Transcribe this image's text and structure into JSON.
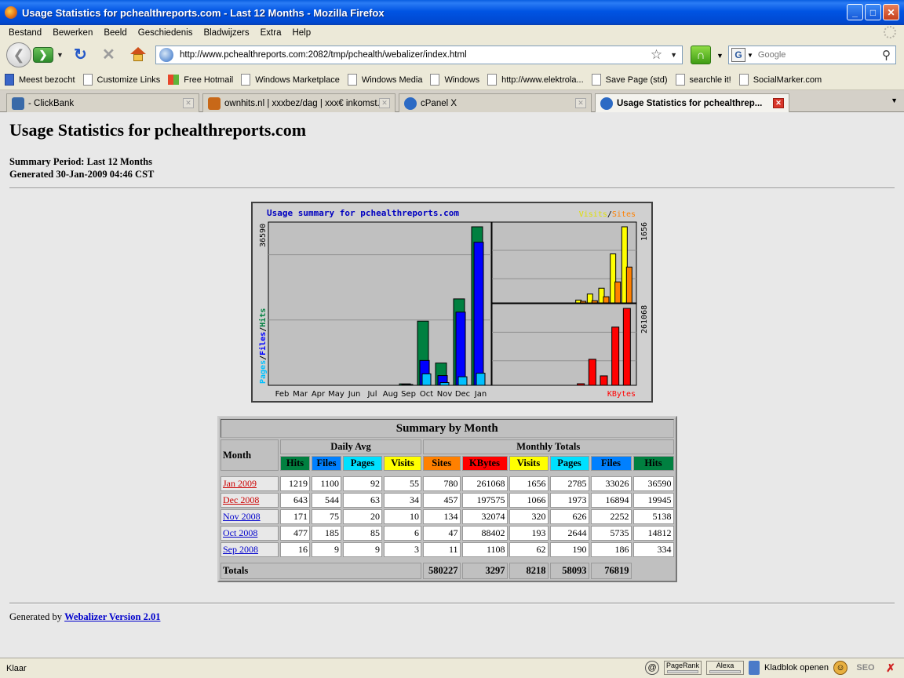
{
  "window": {
    "title": "Usage Statistics for pchealthreports.com - Last 12 Months - Mozilla Firefox",
    "minimize": "_",
    "maximize": "□",
    "close": "✕"
  },
  "menu": [
    "Bestand",
    "Bewerken",
    "Beeld",
    "Geschiedenis",
    "Bladwijzers",
    "Extra",
    "Help"
  ],
  "nav": {
    "url": "http://www.pchealthreports.com:2082/tmp/pchealth/webalizer/index.html",
    "search_placeholder": "Google",
    "search_engine": "G"
  },
  "bookmarks": [
    {
      "label": "Meest bezocht",
      "icon": "smart-folder-icon"
    },
    {
      "label": "Customize Links",
      "icon": "page-icon"
    },
    {
      "label": "Free Hotmail",
      "icon": "windows-logo-icon"
    },
    {
      "label": "Windows Marketplace",
      "icon": "page-icon"
    },
    {
      "label": "Windows Media",
      "icon": "page-icon"
    },
    {
      "label": "Windows",
      "icon": "page-icon"
    },
    {
      "label": "http://www.elektrola...",
      "icon": "page-icon"
    },
    {
      "label": "Save Page (std)",
      "icon": "page-icon"
    },
    {
      "label": "searchle it!",
      "icon": "page-icon"
    },
    {
      "label": "SocialMarker.com",
      "icon": "page-icon"
    }
  ],
  "tabs": [
    {
      "label": "- ClickBank",
      "active": false,
      "color": "#3a6aa8"
    },
    {
      "label": "ownhits.nl | xxxbez/dag | xxx€ inkomst...",
      "active": false,
      "color": "#c86818"
    },
    {
      "label": "cPanel X",
      "active": false,
      "color": "#2c6ac4"
    },
    {
      "label": "Usage Statistics for pchealthrep...",
      "active": true,
      "color": "#2c6ac4"
    }
  ],
  "page": {
    "title": "Usage Statistics for pchealthreports.com",
    "summary_period": "Summary Period: Last 12 Months",
    "generated": "Generated 30-Jan-2009 04:46 CST",
    "footer_prefix": "Generated by",
    "footer_link": "Webalizer Version 2.01"
  },
  "chart_data": {
    "type": "bar",
    "title": "Usage summary for pchealthreports.com",
    "categories": [
      "Feb",
      "Mar",
      "Apr",
      "May",
      "Jun",
      "Jul",
      "Aug",
      "Sep",
      "Oct",
      "Nov",
      "Dec",
      "Jan"
    ],
    "panels": [
      {
        "name": "left",
        "ylabel": [
          "Pages",
          "Files",
          "Hits"
        ],
        "ymax_label": "36590",
        "series": [
          {
            "name": "Hits",
            "color": "#008040",
            "values": [
              0,
              0,
              0,
              0,
              0,
              0,
              0,
              334,
              14812,
              5138,
              19945,
              36590
            ]
          },
          {
            "name": "Files",
            "color": "#0000ff",
            "values": [
              0,
              0,
              0,
              0,
              0,
              0,
              0,
              186,
              5735,
              2252,
              16894,
              33026
            ]
          },
          {
            "name": "Pages",
            "color": "#00c0ff",
            "values": [
              0,
              0,
              0,
              0,
              0,
              0,
              0,
              190,
              2644,
              626,
              1973,
              2785
            ]
          }
        ]
      },
      {
        "name": "top-right",
        "legend": [
          "Visits",
          "Sites"
        ],
        "ymax_label": "1656",
        "series": [
          {
            "name": "Visits",
            "color": "#ffff00",
            "values": [
              0,
              0,
              0,
              0,
              0,
              0,
              0,
              62,
              193,
              320,
              1066,
              1656
            ]
          },
          {
            "name": "Sites",
            "color": "#ff8000",
            "values": [
              0,
              0,
              0,
              0,
              0,
              0,
              0,
              11,
              47,
              134,
              457,
              780
            ]
          }
        ]
      },
      {
        "name": "bottom-right",
        "label": "KBytes",
        "ymax_label": "261068",
        "series": [
          {
            "name": "KBytes",
            "color": "#ff0000",
            "values": [
              0,
              0,
              0,
              0,
              0,
              0,
              0,
              1108,
              88402,
              32074,
              197575,
              261068
            ]
          }
        ]
      }
    ],
    "legend_sep": "/",
    "grid": true
  },
  "table": {
    "caption": "Summary by Month",
    "month_header": "Month",
    "daily_avg": "Daily Avg",
    "monthly_totals": "Monthly Totals",
    "daily_cols": [
      {
        "label": "Hits",
        "color": "#008040"
      },
      {
        "label": "Files",
        "color": "#0080ff"
      },
      {
        "label": "Pages",
        "color": "#00e0ff"
      },
      {
        "label": "Visits",
        "color": "#ffff00"
      }
    ],
    "monthly_cols": [
      {
        "label": "Sites",
        "color": "#ff8000"
      },
      {
        "label": "KBytes",
        "color": "#ff0000"
      },
      {
        "label": "Visits",
        "color": "#ffff00"
      },
      {
        "label": "Pages",
        "color": "#00e0ff"
      },
      {
        "label": "Files",
        "color": "#0080ff"
      },
      {
        "label": "Hits",
        "color": "#008040"
      }
    ],
    "rows": [
      {
        "month": "Jan 2009",
        "visited": true,
        "values": [
          "1219",
          "1100",
          "92",
          "55",
          "780",
          "261068",
          "1656",
          "2785",
          "33026",
          "36590"
        ]
      },
      {
        "month": "Dec 2008",
        "visited": true,
        "values": [
          "643",
          "544",
          "63",
          "34",
          "457",
          "197575",
          "1066",
          "1973",
          "16894",
          "19945"
        ]
      },
      {
        "month": "Nov 2008",
        "visited": false,
        "values": [
          "171",
          "75",
          "20",
          "10",
          "134",
          "32074",
          "320",
          "626",
          "2252",
          "5138"
        ]
      },
      {
        "month": "Oct 2008",
        "visited": false,
        "values": [
          "477",
          "185",
          "85",
          "6",
          "47",
          "88402",
          "193",
          "2644",
          "5735",
          "14812"
        ]
      },
      {
        "month": "Sep 2008",
        "visited": false,
        "values": [
          "16",
          "9",
          "9",
          "3",
          "11",
          "1108",
          "62",
          "190",
          "186",
          "334"
        ]
      }
    ],
    "totals_label": "Totals",
    "totals": [
      "580227",
      "3297",
      "8218",
      "58093",
      "76819"
    ]
  },
  "status": {
    "text": "Klaar",
    "pagerank": "PageRank",
    "alexa": "Alexa",
    "notepad": "Kladblok openen"
  }
}
